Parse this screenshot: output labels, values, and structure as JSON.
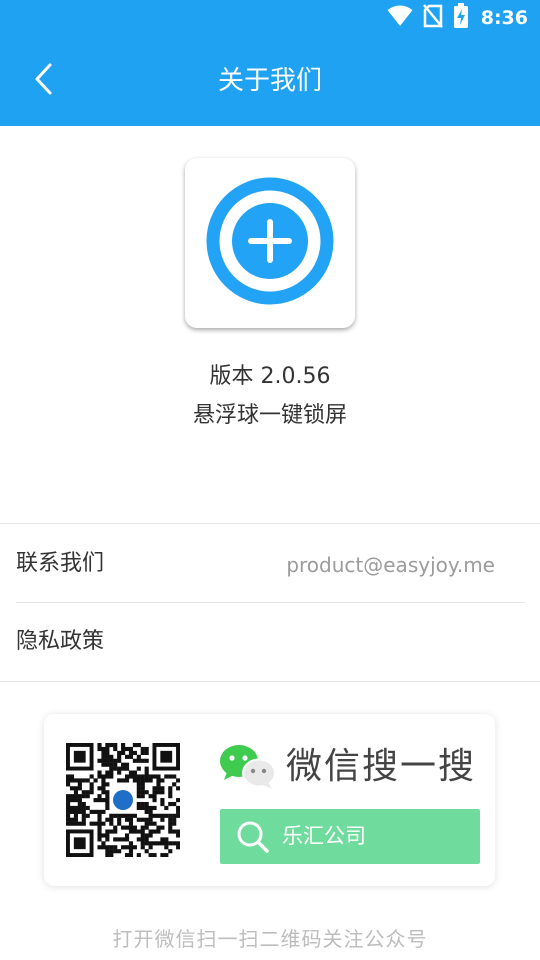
{
  "status_bar": {
    "time": "8:36",
    "icons": [
      "wifi-icon",
      "no-sim-icon",
      "battery-charging-icon"
    ]
  },
  "app_bar": {
    "title": "关于我们",
    "back_icon": "chevron-left-icon",
    "color": "#20a2f2"
  },
  "about": {
    "app_icon": "plus-circle-icon",
    "version": "版本 2.0.56",
    "app_name": "悬浮球一键锁屏"
  },
  "rows": {
    "contact_label": "联系我们",
    "contact_value": "product@easyjoy.me",
    "privacy_label": "隐私政策"
  },
  "wechat_card": {
    "qr_icon": "qr-code-icon",
    "wechat_icon": "wechat-icon",
    "headline": "微信搜一搜",
    "search_icon": "search-icon",
    "search_text": "乐汇公司",
    "search_color": "#6fdc9e"
  },
  "footer": {
    "hint": "打开微信扫一扫二维码关注公众号"
  }
}
